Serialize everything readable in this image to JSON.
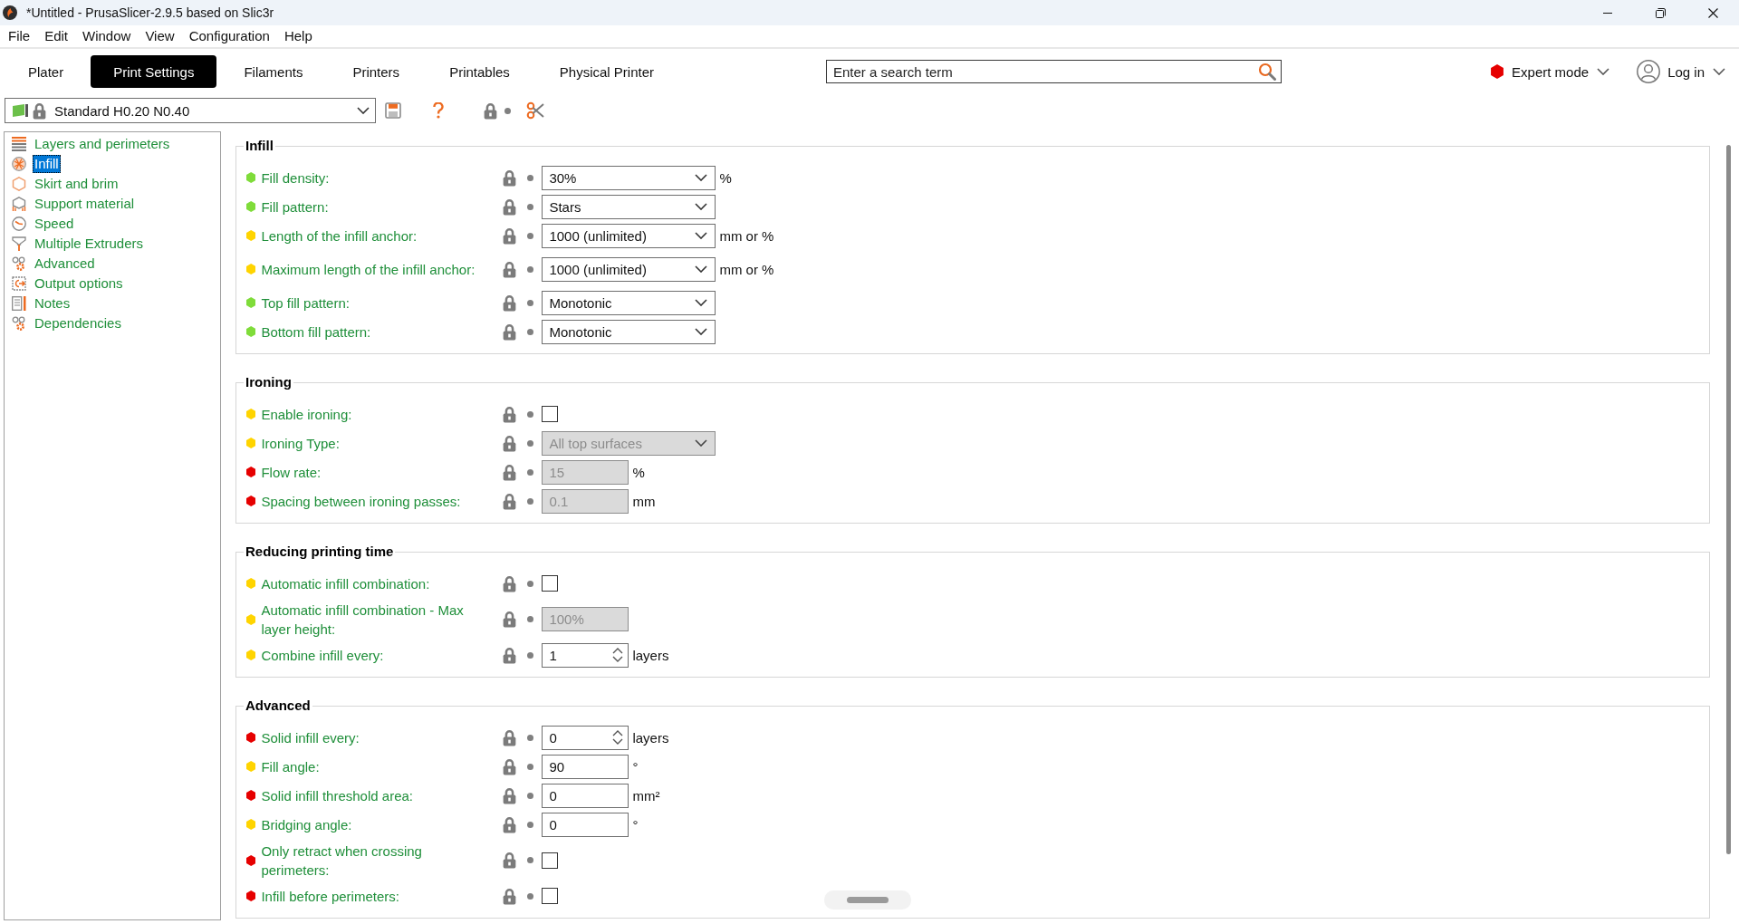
{
  "window": {
    "title": "*Untitled - PrusaSlicer-2.9.5 based on Slic3r"
  },
  "menu": [
    "File",
    "Edit",
    "Window",
    "View",
    "Configuration",
    "Help"
  ],
  "tabs": [
    {
      "label": "Plater",
      "selected": false
    },
    {
      "label": "Print Settings",
      "selected": true
    },
    {
      "label": "Filaments",
      "selected": false
    },
    {
      "label": "Printers",
      "selected": false
    },
    {
      "label": "Printables",
      "selected": false
    },
    {
      "label": "Physical Printer",
      "selected": false
    }
  ],
  "search": {
    "placeholder": "Enter a search term"
  },
  "mode": {
    "label": "Expert mode"
  },
  "account": {
    "label": "Log in"
  },
  "preset": {
    "name": "Standard H0.20 N0.40"
  },
  "sidebar": {
    "items": [
      {
        "label": "Layers and perimeters",
        "selected": false
      },
      {
        "label": "Infill",
        "selected": true
      },
      {
        "label": "Skirt and brim",
        "selected": false
      },
      {
        "label": "Support material",
        "selected": false
      },
      {
        "label": "Speed",
        "selected": false
      },
      {
        "label": "Multiple Extruders",
        "selected": false
      },
      {
        "label": "Advanced",
        "selected": false
      },
      {
        "label": "Output options",
        "selected": false
      },
      {
        "label": "Notes",
        "selected": false
      },
      {
        "label": "Dependencies",
        "selected": false
      }
    ]
  },
  "groups": [
    {
      "title": "Infill",
      "options": [
        {
          "label": "Fill density:",
          "color": "#7fdc3a",
          "kind": "select",
          "value": "30%",
          "unit": "%",
          "disabled": false
        },
        {
          "label": "Fill pattern:",
          "color": "#7fdc3a",
          "kind": "select",
          "value": "Stars",
          "disabled": false
        },
        {
          "label": "Length of the infill anchor:",
          "color": "#ffd400",
          "kind": "select",
          "value": "1000 (unlimited)",
          "unit": "mm or %",
          "disabled": false
        },
        {
          "label": "Maximum length of the infill anchor:",
          "color": "#ffd400",
          "kind": "select",
          "value": "1000 (unlimited)",
          "unit": "mm or %",
          "disabled": false
        },
        {
          "label": "Top fill pattern:",
          "color": "#7fdc3a",
          "kind": "select",
          "value": "Monotonic",
          "disabled": false
        },
        {
          "label": "Bottom fill pattern:",
          "color": "#7fdc3a",
          "kind": "select",
          "value": "Monotonic",
          "disabled": false
        }
      ]
    },
    {
      "title": "Ironing",
      "options": [
        {
          "label": "Enable ironing:",
          "color": "#ffd400",
          "kind": "checkbox",
          "checked": false,
          "disabled": false
        },
        {
          "label": "Ironing Type:",
          "color": "#ffd400",
          "kind": "select",
          "value": "All top surfaces",
          "disabled": true
        },
        {
          "label": "Flow rate:",
          "color": "#e60000",
          "kind": "text",
          "value": "15",
          "unit": "%",
          "disabled": true
        },
        {
          "label": "Spacing between ironing passes:",
          "color": "#e60000",
          "kind": "text",
          "value": "0.1",
          "unit": "mm",
          "disabled": true
        }
      ]
    },
    {
      "title": "Reducing printing time",
      "options": [
        {
          "label": "Automatic infill combination:",
          "color": "#ffd400",
          "kind": "checkbox",
          "checked": false,
          "disabled": false
        },
        {
          "label": "Automatic infill combination - Max layer height:",
          "color": "#ffd400",
          "kind": "text",
          "value": "100%",
          "disabled": true
        },
        {
          "label": "Combine infill every:",
          "color": "#ffd400",
          "kind": "spin",
          "value": "1",
          "unit": "layers",
          "disabled": false
        }
      ]
    },
    {
      "title": "Advanced",
      "options": [
        {
          "label": "Solid infill every:",
          "color": "#e60000",
          "kind": "spin",
          "value": "0",
          "unit": "layers",
          "disabled": false
        },
        {
          "label": "Fill angle:",
          "color": "#ffd400",
          "kind": "text",
          "value": "90",
          "unit": "°",
          "disabled": false
        },
        {
          "label": "Solid infill threshold area:",
          "color": "#e60000",
          "kind": "text",
          "value": "0",
          "unit": "mm²",
          "disabled": false
        },
        {
          "label": "Bridging angle:",
          "color": "#ffd400",
          "kind": "text",
          "value": "0",
          "unit": "°",
          "disabled": false
        },
        {
          "label": "Only retract when crossing perimeters:",
          "color": "#e60000",
          "kind": "checkbox",
          "checked": false,
          "disabled": false
        },
        {
          "label": "Infill before perimeters:",
          "color": "#e60000",
          "kind": "checkbox",
          "checked": false,
          "disabled": false
        }
      ]
    }
  ]
}
